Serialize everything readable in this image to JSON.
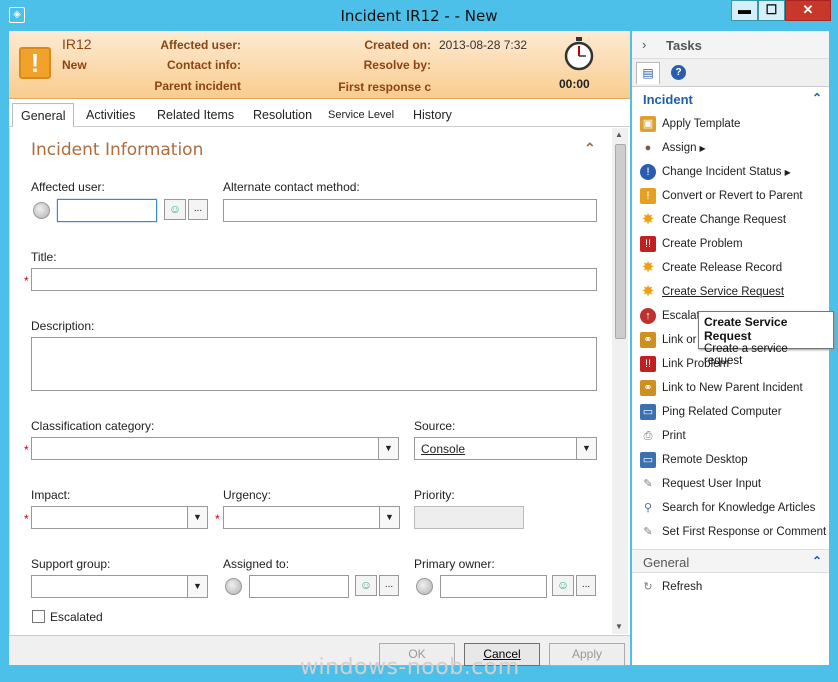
{
  "window": {
    "title": "Incident IR12 -  - New",
    "min_glyph": "▬",
    "max_glyph": "☐",
    "close_glyph": "✕"
  },
  "header": {
    "id": "IR12",
    "status": "New",
    "affected_user_label": "Affected user:",
    "contact_info_label": "Contact info:",
    "parent_incident_label": "Parent incident",
    "created_on_label": "Created on:",
    "created_on_value": "2013-08-28 7:32",
    "resolve_by_label": "Resolve by:",
    "first_response_label": "First response c",
    "timer_value": "00:00"
  },
  "tabs": [
    {
      "label": "General",
      "active": true
    },
    {
      "label": "Activities"
    },
    {
      "label": "Related Items"
    },
    {
      "label": "Resolution"
    },
    {
      "label": "Service Level"
    },
    {
      "label": "History"
    }
  ],
  "form": {
    "section_title": "Incident Information",
    "collapse_glyph": "⌃",
    "affected_user_label": "Affected user:",
    "alternate_contact_label": "Alternate contact method:",
    "title_label": "Title:",
    "description_label": "Description:",
    "classification_label": "Classification category:",
    "source_label": "Source:",
    "source_value": "Console",
    "impact_label": "Impact:",
    "urgency_label": "Urgency:",
    "priority_label": "Priority:",
    "support_group_label": "Support group:",
    "assigned_to_label": "Assigned to:",
    "primary_owner_label": "Primary owner:",
    "escalated_label": "Escalated",
    "required_glyph": "*",
    "browse_glyph": "...",
    "dropdown_glyph": "▼"
  },
  "footer": {
    "ok": "OK",
    "cancel": "Cancel",
    "apply": "Apply"
  },
  "watermark": "windows-noob.com",
  "tasks": {
    "title": "Tasks",
    "incident_section": "Incident",
    "general_section": "General",
    "items": [
      {
        "label": "Apply Template",
        "icon": "template-icon",
        "color": "#e0a030"
      },
      {
        "label": "Assign",
        "icon": "user-icon",
        "color": "#7a5a40"
      },
      {
        "label": "Change Incident Status",
        "icon": "info-icon",
        "color": "#2a5db0"
      },
      {
        "label": "Convert or Revert to Parent",
        "icon": "convert-icon",
        "color": "#e8a020"
      },
      {
        "label": "Create Change Request",
        "icon": "star-icon",
        "color": "#f0a010"
      },
      {
        "label": "Create Problem",
        "icon": "problem-icon",
        "color": "#c02020"
      },
      {
        "label": "Create Release Record",
        "icon": "star-icon",
        "color": "#f0a010"
      },
      {
        "label": "Create Service Request",
        "icon": "star-icon",
        "color": "#f0a010"
      },
      {
        "label": "Escalate",
        "icon": "escalate-icon",
        "color": "#c03030"
      },
      {
        "label": "Link or",
        "icon": "link-icon",
        "color": "#d09020"
      },
      {
        "label": "Link Problem",
        "icon": "problem-icon",
        "color": "#c02020"
      },
      {
        "label": "Link to New Parent Incident",
        "icon": "link-icon",
        "color": "#d09020"
      },
      {
        "label": "Ping Related Computer",
        "icon": "computer-icon",
        "color": "#3a70b0"
      },
      {
        "label": "Print",
        "icon": "print-icon",
        "color": "#707070"
      },
      {
        "label": "Remote Desktop",
        "icon": "remote-icon",
        "color": "#3a70b0"
      },
      {
        "label": "Request User Input",
        "icon": "request-icon",
        "color": "#7a7a7a"
      },
      {
        "label": "Search for Knowledge Articles",
        "icon": "search-icon",
        "color": "#4a6aa0"
      },
      {
        "label": "Set First Response or Comment",
        "icon": "comment-icon",
        "color": "#7a7a7a"
      }
    ],
    "general_items": [
      {
        "label": "Refresh",
        "icon": "refresh-icon",
        "color": "#7a7a7a"
      }
    ]
  },
  "tooltip": {
    "title": "Create Service Request",
    "body": "Create a service request"
  }
}
